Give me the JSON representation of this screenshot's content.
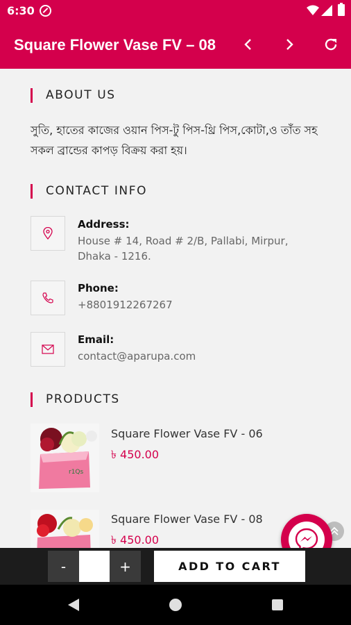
{
  "status_bar": {
    "time": "6:30"
  },
  "app_bar": {
    "title": "Square Flower Vase FV – 08"
  },
  "about": {
    "heading": "ABOUT US",
    "text": "সুতি, হাতের কাজের ওয়ান পিস-টু পিস-থ্রি পিস,কোটা,ও তাঁত সহ সকল ব্রান্ডের কাপড় বিক্রয় করা হয়।"
  },
  "contact": {
    "heading": "CONTACT INFO",
    "address_label": "Address:",
    "address_value": "House # 14, Road # 2/B, Pallabi, Mirpur, Dhaka - 1216.",
    "phone_label": "Phone:",
    "phone_value": "+8801912267267",
    "email_label": "Email:",
    "email_value": "contact@aparupa.com"
  },
  "products": {
    "heading": "PRODUCTS",
    "items": [
      {
        "name": "Square Flower Vase FV - 06",
        "price": "৳ 450.00"
      },
      {
        "name": "Square Flower Vase FV - 08",
        "price": "৳ 450.00"
      }
    ]
  },
  "cart": {
    "minus_label": "-",
    "plus_label": "+",
    "quantity": "",
    "add_label": "ADD TO CART"
  },
  "colors": {
    "accent": "#d4004c",
    "bottom_bar": "#1c1c1c"
  },
  "icons": {
    "back": "chevron-left-icon",
    "forward": "chevron-right-icon",
    "reload": "refresh-icon",
    "address": "location-pin-icon",
    "phone": "phone-icon",
    "email": "envelope-icon",
    "messenger": "messenger-icon",
    "scroll_top": "double-chevron-up-icon"
  }
}
